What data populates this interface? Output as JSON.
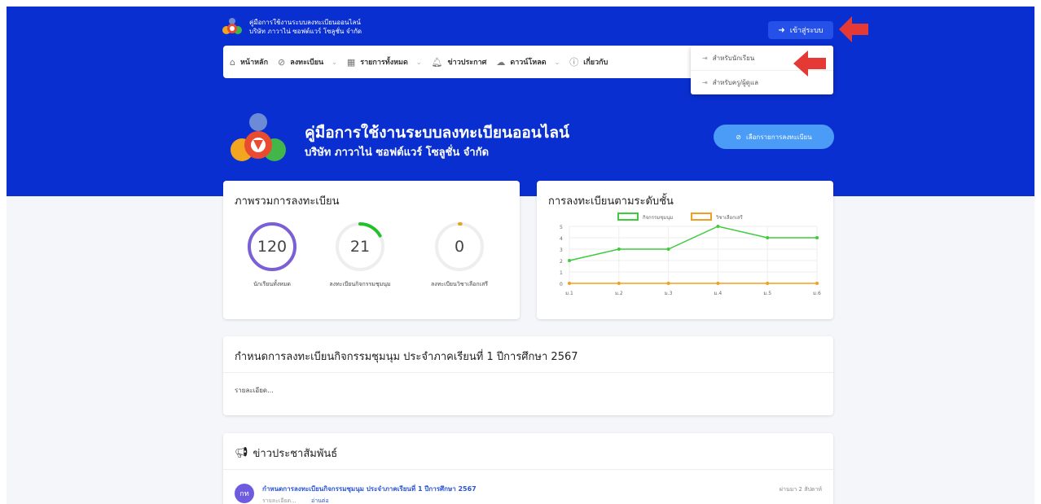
{
  "header": {
    "brand_line1": "คู่มือการใช้งานระบบลงทะเบียนออนไลน์",
    "brand_line2": "บริษัท ภาวาไน่ ซอฟต์แวร์ โซลูชั่น จำกัด",
    "login_label": "เข้าสู่ระบบ"
  },
  "nav": {
    "items": [
      {
        "label": "หน้าหลัก",
        "icon": "home-icon"
      },
      {
        "label": "ลงทะเบียน",
        "icon": "check-circle-icon",
        "dropdown": true
      },
      {
        "label": "รายการทั้งหมด",
        "icon": "grid-icon",
        "dropdown": true
      },
      {
        "label": "ข่าวประกาศ",
        "icon": "bell-icon"
      },
      {
        "label": "ดาวน์โหลด",
        "icon": "cloud-download-icon",
        "dropdown": true
      },
      {
        "label": "เกี่ยวกับ",
        "icon": "info-icon"
      }
    ]
  },
  "login_menu": {
    "items": [
      {
        "label": "สำหรับนักเรียน"
      },
      {
        "label": "สำหรับครู/ผู้ดูแล"
      }
    ]
  },
  "hero": {
    "title": "คู่มือการใช้งานระบบลงทะเบียนออนไลน์",
    "subtitle": "บริษัท ภาวาไน่ ซอฟต์แวร์ โซลูชั่น จำกัด",
    "select_button": "เลือกรายการลงทะเบียน"
  },
  "overview": {
    "title": "ภาพรวมการลงทะเบียน",
    "rings": [
      {
        "value": "120",
        "label": "นักเรียนทั้งหมด",
        "fraction": 1.0,
        "color": "#7b5fd6"
      },
      {
        "value": "21",
        "label": "ลงทะเบียนกิจกรรมชุมนุม",
        "fraction": 0.17,
        "color": "#22c02a"
      },
      {
        "value": "0",
        "label": "ลงทะเบียนวิชาเลือกเสรี",
        "fraction": 0.01,
        "color": "#f0a020"
      }
    ]
  },
  "level_chart": {
    "title": "การลงทะเบียนตามระดับชั้น"
  },
  "chart_data": {
    "type": "line",
    "categories": [
      "ม.1",
      "ม.2",
      "ม.3",
      "ม.4",
      "ม.5",
      "ม.6"
    ],
    "series": [
      {
        "name": "กิจกรรมชุมนุม",
        "values": [
          2,
          3,
          3,
          5,
          4,
          4
        ],
        "color": "#3ecb3e"
      },
      {
        "name": "วิชาเลือกเสรี",
        "values": [
          0,
          0,
          0,
          0,
          0,
          0
        ],
        "color": "#f0a020"
      }
    ],
    "y_ticks": [
      "0",
      "1",
      "2",
      "3",
      "4",
      "5"
    ],
    "ylim": [
      0,
      5
    ],
    "grid": true,
    "legend": "top"
  },
  "announcement": {
    "title": "กำหนดการลงทะเบียนกิจกรรมชุมนุม ประจำภาคเรียนที่ 1 ปีการศึกษา 2567",
    "detail": "รายละเอียด..."
  },
  "news": {
    "title": "ข่าวประชาสัมพันธ์",
    "items": [
      {
        "avatar": "กท",
        "title": "กำหนดการลงทะเบียนกิจกรรมชุมนุม ประจำภาคเรียนที่ 1 ปีการศึกษา 2567",
        "time": "ผ่านมา 2 สัปดาห์",
        "sub_detail": "รายละเอียด...",
        "sub_link": "อ่านต่อ"
      }
    ]
  },
  "colors": {
    "hero_blue": "#0a2fd1",
    "arrow_red": "#e53935"
  }
}
